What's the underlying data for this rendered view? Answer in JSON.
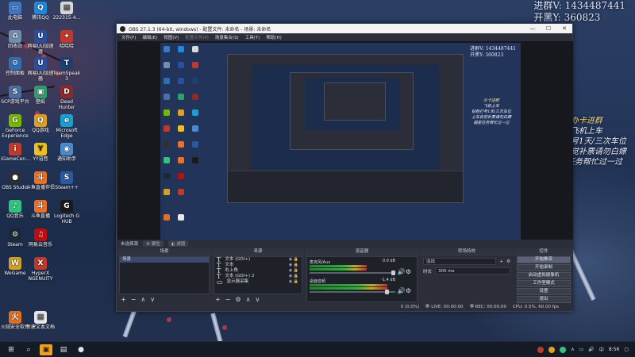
{
  "stream_overlay": {
    "qq_group": "进群V: 1434487441",
    "black_car": "开黑Y: 360823",
    "right_lines": [
      "办卡进群",
      "飞机上车",
      "钻粉打号1天/三次车位",
      "上车自觉补票请勿白嫖",
      "福星任务帮忙过一过"
    ]
  },
  "desktop_icons": [
    {
      "label": "此电脑",
      "icon": "computer-icon",
      "color": "#3a78c8"
    },
    {
      "label": "腾讯QQ",
      "icon": "qq-icon",
      "color": "#1a8be0"
    },
    {
      "label": "222315-4...",
      "icon": "document-icon",
      "color": "#d9d9d9"
    },
    {
      "label": "回收站",
      "icon": "recycle-bin-icon",
      "color": "#6f8fb0"
    },
    {
      "label": "网易UU加速器",
      "icon": "uu-accelerator-icon",
      "color": "#2a4ea0"
    },
    {
      "label": "哈哈哈",
      "icon": "game-icon",
      "color": "#c0392b"
    },
    {
      "label": "控制面板",
      "icon": "control-panel-icon",
      "color": "#2d6fb3"
    },
    {
      "label": "网易UU加速器",
      "icon": "uu-accelerator-icon",
      "color": "#2a4ea0"
    },
    {
      "label": "TeamSpeak 3",
      "icon": "teamspeak-icon",
      "color": "#1f3f6f"
    },
    {
      "label": "SCP游戏平台",
      "icon": "scp-icon",
      "color": "#4a6fa0"
    },
    {
      "label": "壁纸",
      "icon": "wallpaper-icon",
      "color": "#2f9f6f"
    },
    {
      "label": "Dead Hunter",
      "icon": "dead-hunter-icon",
      "color": "#8a2a2a"
    },
    {
      "label": "GeForce Experience",
      "icon": "geforce-icon",
      "color": "#76b900"
    },
    {
      "label": "QQ游戏",
      "icon": "qq-game-icon",
      "color": "#e0a020"
    },
    {
      "label": "Microsoft Edge",
      "icon": "edge-icon",
      "color": "#1a9fd0"
    },
    {
      "label": "iGameCen...",
      "icon": "igame-icon",
      "color": "#c0392b"
    },
    {
      "label": "YY语音",
      "icon": "yy-icon",
      "color": "#f0c020"
    },
    {
      "label": "通知助手",
      "icon": "assistant-icon",
      "color": "#4a8ad0"
    },
    {
      "label": "OBS Studio",
      "icon": "obs-icon",
      "color": "#303030"
    },
    {
      "label": "斗鱼直播伴侣",
      "icon": "douyu-icon",
      "color": "#f07020"
    },
    {
      "label": "Steam++",
      "icon": "steam-plus-icon",
      "color": "#2a5aa0"
    },
    {
      "label": "QQ音乐",
      "icon": "qq-music-icon",
      "color": "#31c27c"
    },
    {
      "label": "斗鱼直播",
      "icon": "douyu-live-icon",
      "color": "#f07020"
    },
    {
      "label": "Logitech G HUB",
      "icon": "logitech-icon",
      "color": "#1a1a1a"
    },
    {
      "label": "Steam",
      "icon": "steam-icon",
      "color": "#1b2838"
    },
    {
      "label": "网易云音乐",
      "icon": "netease-music-icon",
      "color": "#c20c0c"
    },
    {
      "label": "WeGame",
      "icon": "wegame-icon",
      "color": "#d4a020"
    },
    {
      "label": "HyperX NGENUITY",
      "icon": "hyperx-icon",
      "color": "#c0392b"
    },
    {
      "label": "火绒安全软件",
      "icon": "huorong-icon",
      "color": "#e07020"
    },
    {
      "label": "新建文本文档",
      "icon": "text-file-icon",
      "color": "#e8e8e8"
    }
  ],
  "obs": {
    "title": "OBS 27.1.3 (64-bit, windows) - 配置文件: 未命名 - 场景: 未命名",
    "menu": [
      "文件(F)",
      "编辑(E)",
      "视图(V)",
      "配置文件(P)",
      "场景集合(S)",
      "工具(T)",
      "帮助(H)"
    ],
    "no_source_selected": "未选择源",
    "properties_btn": "属性",
    "filters_btn": "滤镜",
    "docks": {
      "scenes": "场景",
      "sources": "来源",
      "mixer": "混音器",
      "transitions": "转场特效",
      "controls": "控件"
    },
    "scenes_list": [
      "场景"
    ],
    "sources_list": [
      {
        "label": "文本 (GDI+)",
        "type": "text"
      },
      {
        "label": "文本",
        "type": "text"
      },
      {
        "label": "右上角",
        "type": "text"
      },
      {
        "label": "文本 (GDI+) 2",
        "type": "text"
      },
      {
        "label": "显示器采集",
        "type": "display"
      }
    ],
    "mixer": [
      {
        "name": "麦克风/Aux",
        "db": "0.0 dB"
      },
      {
        "name": "桌面音频",
        "db": "-1.4 dB"
      }
    ],
    "transition": {
      "type": "淡出",
      "duration_label": "时长",
      "duration_value": "300 ms"
    },
    "controls": [
      "开始推流",
      "开始录制",
      "启动虚拟摄像机",
      "工作室模式",
      "设置",
      "退出"
    ],
    "status": {
      "drop": "0 (0.0%)",
      "live": "LIVE: 00:00:00",
      "rec": "REC: 00:00:00",
      "cpu": "CPU: 0.5%, 60.00 fps"
    },
    "preview_overlay": {
      "qq_group": "进群V: 1434487441",
      "black_car": "开黑Y: 360823",
      "lines": [
        "办卡进群",
        "飞机上车",
        "钻粉打号1天/三次车位",
        "上车自觉补票请勿白嫖",
        "福星任务帮忙过一过"
      ]
    }
  },
  "taskbar": {
    "clock": "8:56",
    "icons": [
      "windows-start-icon",
      "search-icon",
      "task-view-icon",
      "file-explorer-icon",
      "obs-taskbar-icon",
      "browser-icon",
      "chat-icon"
    ]
  }
}
